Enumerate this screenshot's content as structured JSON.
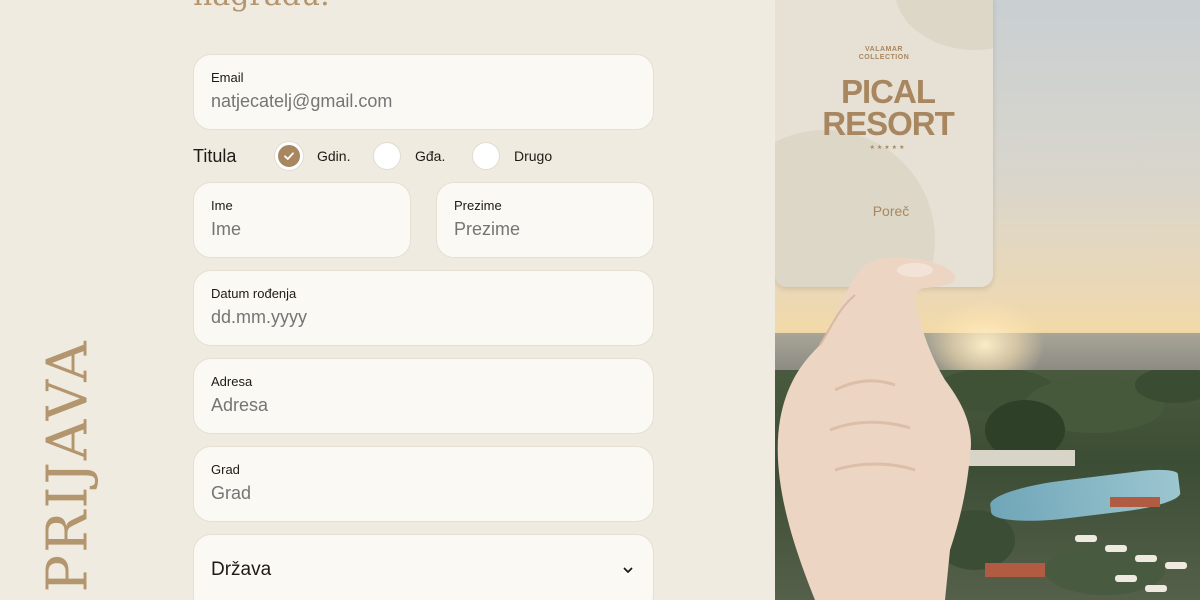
{
  "heading_fragment": "nagradu.",
  "side_word": "PRIJAVA",
  "form": {
    "email": {
      "label": "Email",
      "placeholder": "natjecatelj@gmail.com"
    },
    "titula": {
      "label": "Titula",
      "options": [
        {
          "label": "Gdin.",
          "checked": true
        },
        {
          "label": "Gđa.",
          "checked": false
        },
        {
          "label": "Drugo",
          "checked": false
        }
      ]
    },
    "first_name": {
      "label": "Ime",
      "placeholder": "Ime"
    },
    "last_name": {
      "label": "Prezime",
      "placeholder": "Prezime"
    },
    "birth_date": {
      "label": "Datum rođenja",
      "placeholder": "dd.mm.yyyy"
    },
    "address": {
      "label": "Adresa",
      "placeholder": "Adresa"
    },
    "city": {
      "label": "Grad",
      "placeholder": "Grad"
    },
    "country": {
      "value": "Država",
      "icon": "chevron-down-icon"
    }
  },
  "card": {
    "brand_line1": "VALAMAR",
    "brand_line2": "COLLECTION",
    "name_line1": "PICAL",
    "name_line2": "RESORT",
    "stars": "★★★★★",
    "city": "Poreč"
  },
  "colors": {
    "background": "#f0ebe1",
    "accent": "#a88760",
    "field_bg": "#fbf9f4"
  }
}
